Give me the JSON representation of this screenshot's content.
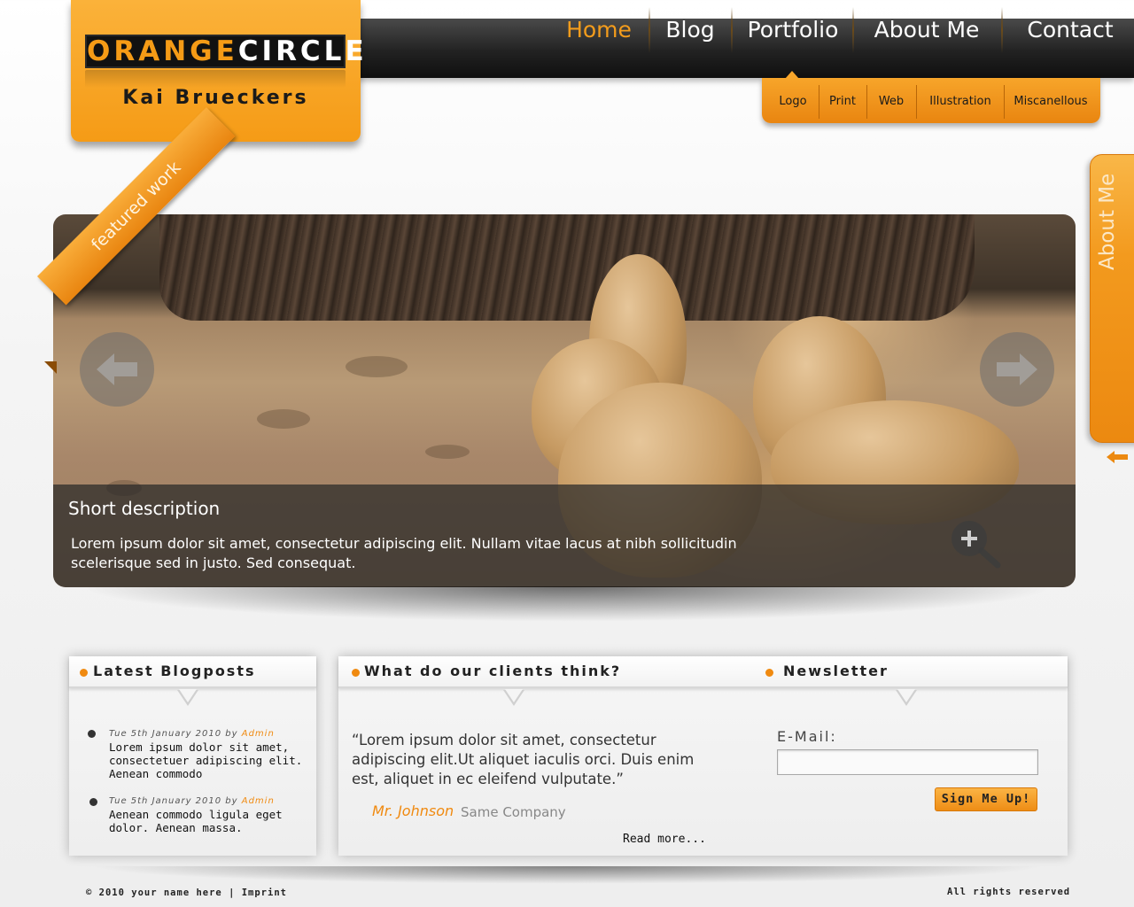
{
  "brand": {
    "logo_part1": "ORANGE",
    "logo_part2": "CIRCLE",
    "name": "Kai Brueckers",
    "accent_color": "#f59b16"
  },
  "nav": {
    "items": [
      {
        "label": "Home",
        "active": true
      },
      {
        "label": "Blog",
        "active": false
      },
      {
        "label": "Portfolio",
        "active": false
      },
      {
        "label": "About Me",
        "active": false
      },
      {
        "label": "Contact",
        "active": false
      }
    ]
  },
  "subnav": {
    "items": [
      {
        "label": "Logo"
      },
      {
        "label": "Print"
      },
      {
        "label": "Web"
      },
      {
        "label": "Illustration"
      },
      {
        "label": "Miscanellous"
      }
    ]
  },
  "side_tab": {
    "label": "About Me",
    "arrow_icon": "arrow-left-icon"
  },
  "featured": {
    "ribbon": "featured work",
    "caption_title": "Short description",
    "caption_text": "Lorem ipsum dolor sit amet, consectetur adipiscing elit. Nullam vitae lacus at nibh sollicitudin scelerisque sed in justo. Sed consequat.",
    "prev_icon": "arrow-left-icon",
    "next_icon": "arrow-right-icon",
    "zoom_icon": "zoom-in-icon"
  },
  "blog": {
    "title": "Latest Blogposts",
    "posts": [
      {
        "date": "Tue 5th January 2010 by ",
        "author": "Admin",
        "text": "Lorem ipsum dolor sit amet, consectetuer adipiscing elit. Aenean commodo"
      },
      {
        "date": "Tue 5th January 2010 by ",
        "author": "Admin",
        "text": "Aenean commodo ligula eget dolor. Aenean massa."
      }
    ]
  },
  "clients": {
    "title": "What do our clients think?",
    "quote": "“Lorem ipsum dolor sit amet, consectetur adipiscing elit.Ut aliquet iaculis orci. Duis enim est, aliquet in ec eleifend vulputate.”",
    "author": "Mr. Johnson",
    "company": "Same Company",
    "read_more": "Read more..."
  },
  "newsletter": {
    "title": "Newsletter",
    "email_label": "E-Mail:",
    "email_value": "",
    "button_label": "Sign Me Up!"
  },
  "footer": {
    "copyright": "© 2010 your name here | ",
    "imprint": "Imprint",
    "rights": "All rights reserved"
  }
}
